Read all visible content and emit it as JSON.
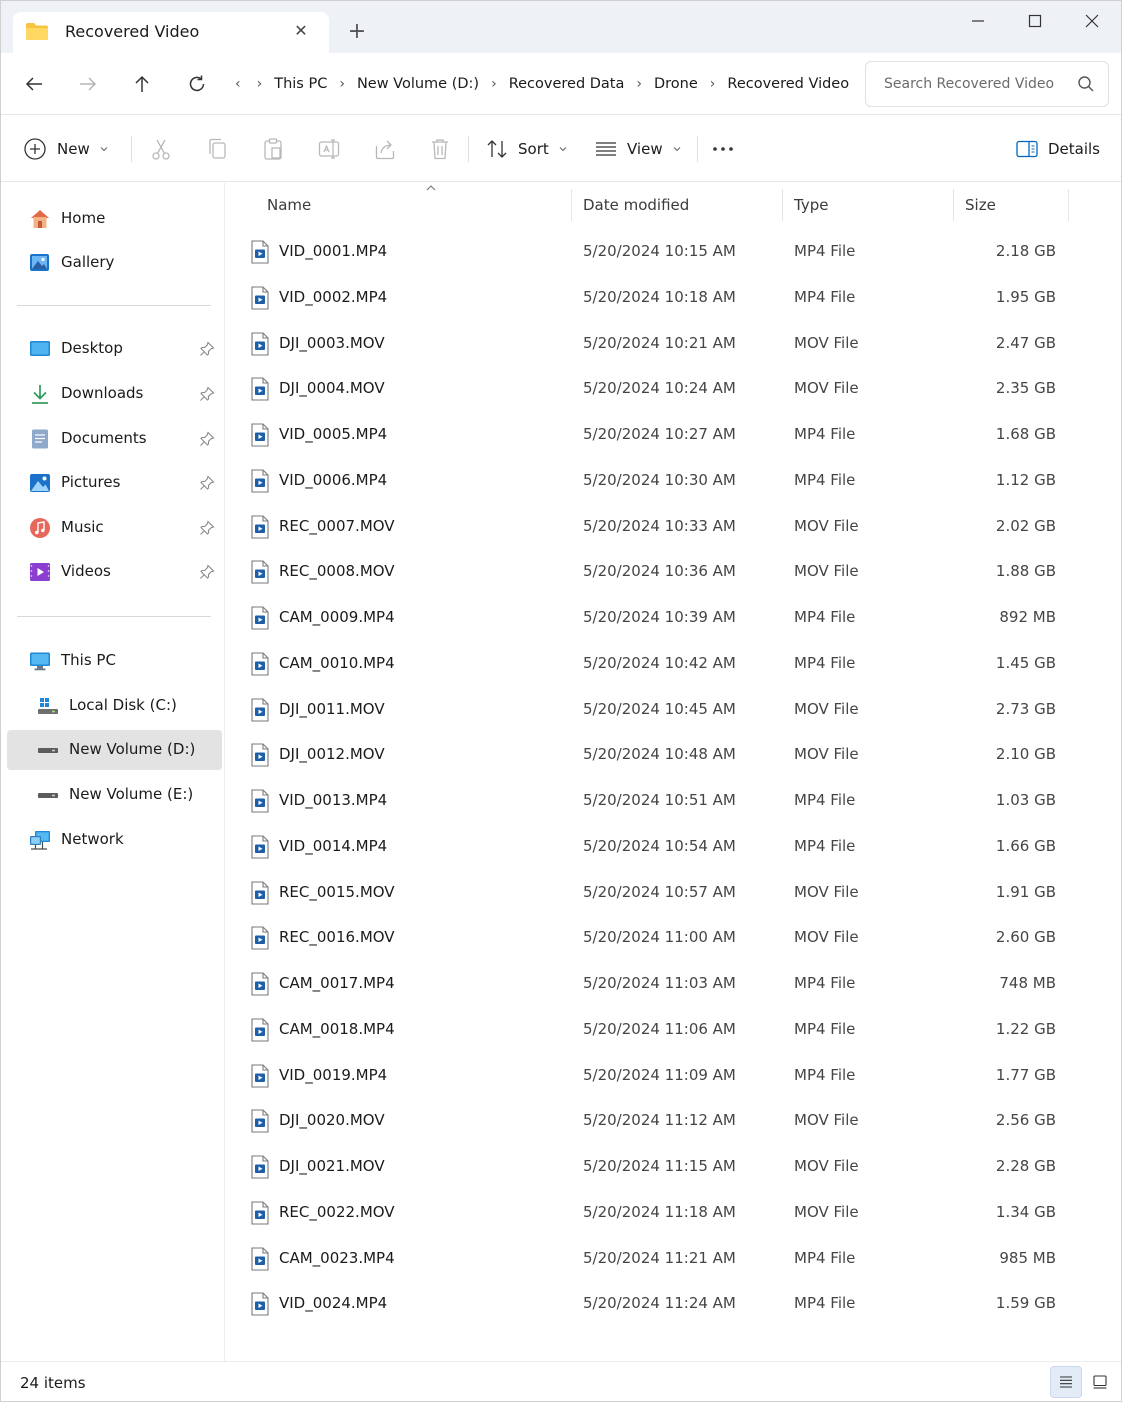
{
  "tab": {
    "title": "Recovered Video"
  },
  "breadcrumb": [
    "This PC",
    "New Volume (D:)",
    "Recovered Data",
    "Drone",
    "Recovered Video"
  ],
  "search": {
    "placeholder": "Search Recovered Video"
  },
  "commandbar": {
    "new_label": "New",
    "sort_label": "Sort",
    "view_label": "View",
    "details_label": "Details"
  },
  "sidebar": {
    "home": "Home",
    "gallery": "Gallery",
    "desktop": "Desktop",
    "downloads": "Downloads",
    "documents": "Documents",
    "pictures": "Pictures",
    "music": "Music",
    "videos": "Videos",
    "this_pc": "This PC",
    "local_disk": "Local Disk (C:)",
    "new_volume_d": "New Volume (D:)",
    "new_volume_e": "New Volume (E:)",
    "network": "Network",
    "selected": "New Volume (D:)"
  },
  "columns": {
    "name": "Name",
    "date": "Date modified",
    "type": "Type",
    "size": "Size"
  },
  "files": [
    {
      "name": "VID_0001.MP4",
      "date": "5/20/2024 10:15 AM",
      "type": "MP4 File",
      "size": "2.18 GB"
    },
    {
      "name": "VID_0002.MP4",
      "date": "5/20/2024 10:18 AM",
      "type": "MP4 File",
      "size": "1.95 GB"
    },
    {
      "name": "DJI_0003.MOV",
      "date": "5/20/2024 10:21 AM",
      "type": "MOV File",
      "size": "2.47 GB"
    },
    {
      "name": "DJI_0004.MOV",
      "date": "5/20/2024 10:24 AM",
      "type": "MOV File",
      "size": "2.35 GB"
    },
    {
      "name": "VID_0005.MP4",
      "date": "5/20/2024 10:27 AM",
      "type": "MP4 File",
      "size": "1.68 GB"
    },
    {
      "name": "VID_0006.MP4",
      "date": "5/20/2024 10:30 AM",
      "type": "MP4 File",
      "size": "1.12 GB"
    },
    {
      "name": "REC_0007.MOV",
      "date": "5/20/2024 10:33 AM",
      "type": "MOV File",
      "size": "2.02 GB"
    },
    {
      "name": "REC_0008.MOV",
      "date": "5/20/2024 10:36 AM",
      "type": "MOV File",
      "size": "1.88 GB"
    },
    {
      "name": "CAM_0009.MP4",
      "date": "5/20/2024 10:39 AM",
      "type": "MP4 File",
      "size": "892 MB"
    },
    {
      "name": "CAM_0010.MP4",
      "date": "5/20/2024 10:42 AM",
      "type": "MP4 File",
      "size": "1.45 GB"
    },
    {
      "name": "DJI_0011.MOV",
      "date": "5/20/2024 10:45 AM",
      "type": "MOV File",
      "size": "2.73 GB"
    },
    {
      "name": "DJI_0012.MOV",
      "date": "5/20/2024 10:48 AM",
      "type": "MOV File",
      "size": "2.10 GB"
    },
    {
      "name": "VID_0013.MP4",
      "date": "5/20/2024 10:51 AM",
      "type": "MP4 File",
      "size": "1.03 GB"
    },
    {
      "name": "VID_0014.MP4",
      "date": "5/20/2024 10:54 AM",
      "type": "MP4 File",
      "size": "1.66 GB"
    },
    {
      "name": "REC_0015.MOV",
      "date": "5/20/2024 10:57 AM",
      "type": "MOV File",
      "size": "1.91 GB"
    },
    {
      "name": "REC_0016.MOV",
      "date": "5/20/2024 11:00 AM",
      "type": "MOV File",
      "size": "2.60 GB"
    },
    {
      "name": "CAM_0017.MP4",
      "date": "5/20/2024 11:03 AM",
      "type": "MP4 File",
      "size": "748 MB"
    },
    {
      "name": "CAM_0018.MP4",
      "date": "5/20/2024 11:06 AM",
      "type": "MP4 File",
      "size": "1.22 GB"
    },
    {
      "name": "VID_0019.MP4",
      "date": "5/20/2024 11:09 AM",
      "type": "MP4 File",
      "size": "1.77 GB"
    },
    {
      "name": "DJI_0020.MOV",
      "date": "5/20/2024 11:12 AM",
      "type": "MOV File",
      "size": "2.56 GB"
    },
    {
      "name": "DJI_0021.MOV",
      "date": "5/20/2024 11:15 AM",
      "type": "MOV File",
      "size": "2.28 GB"
    },
    {
      "name": "REC_0022.MOV",
      "date": "5/20/2024 11:18 AM",
      "type": "MOV File",
      "size": "1.34 GB"
    },
    {
      "name": "CAM_0023.MP4",
      "date": "5/20/2024 11:21 AM",
      "type": "MP4 File",
      "size": "985 MB"
    },
    {
      "name": "VID_0024.MP4",
      "date": "5/20/2024 11:24 AM",
      "type": "MP4 File",
      "size": "1.59 GB"
    }
  ],
  "status": {
    "item_count": "24 items"
  },
  "colors": {
    "accent": "#0067c0",
    "selected_bg": "#e3e3e3",
    "titlebar_bg": "#eef1f6",
    "folder": "#f8c33e"
  }
}
